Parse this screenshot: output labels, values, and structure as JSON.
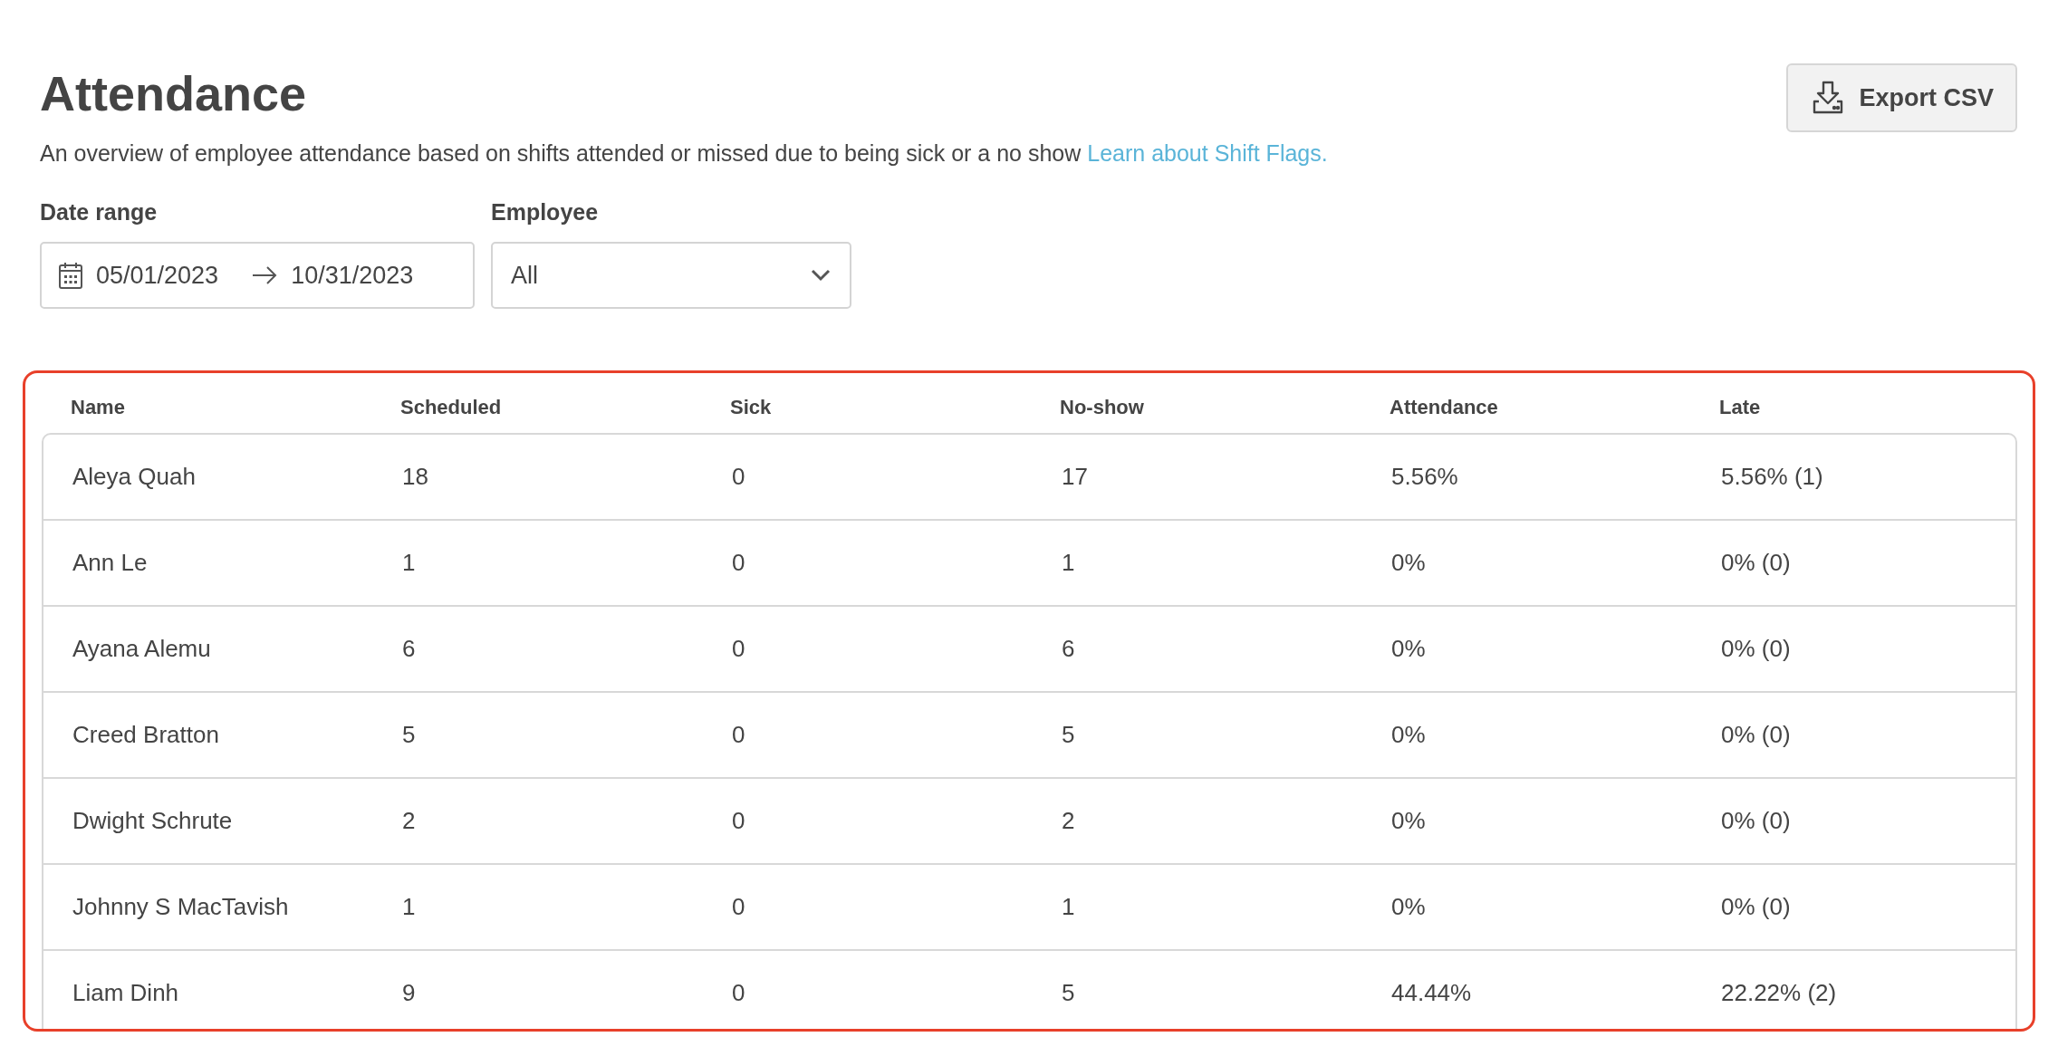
{
  "page": {
    "title": "Attendance",
    "description": "An overview of employee attendance based on shifts attended or missed due to being sick or a no show",
    "learn_link": "Learn about Shift Flags.",
    "export_button": "Export CSV"
  },
  "filters": {
    "date_range": {
      "label": "Date range",
      "start": "05/01/2023",
      "end": "10/31/2023"
    },
    "employee": {
      "label": "Employee",
      "value": "All"
    }
  },
  "table": {
    "highlighted": true,
    "columns": [
      "Name",
      "Scheduled",
      "Sick",
      "No-show",
      "Attendance",
      "Late"
    ],
    "rows": [
      [
        "Aleya Quah",
        "18",
        "0",
        "17",
        "5.56%",
        "5.56% (1)"
      ],
      [
        "Ann Le",
        "1",
        "0",
        "1",
        "0%",
        "0% (0)"
      ],
      [
        "Ayana Alemu",
        "6",
        "0",
        "6",
        "0%",
        "0% (0)"
      ],
      [
        "Creed Bratton",
        "5",
        "0",
        "5",
        "0%",
        "0% (0)"
      ],
      [
        "Dwight Schrute",
        "2",
        "0",
        "2",
        "0%",
        "0% (0)"
      ],
      [
        "Johnny S MacTavish",
        "1",
        "0",
        "1",
        "0%",
        "0% (0)"
      ],
      [
        "Liam Dinh",
        "9",
        "0",
        "5",
        "44.44%",
        "22.22% (2)"
      ]
    ]
  }
}
